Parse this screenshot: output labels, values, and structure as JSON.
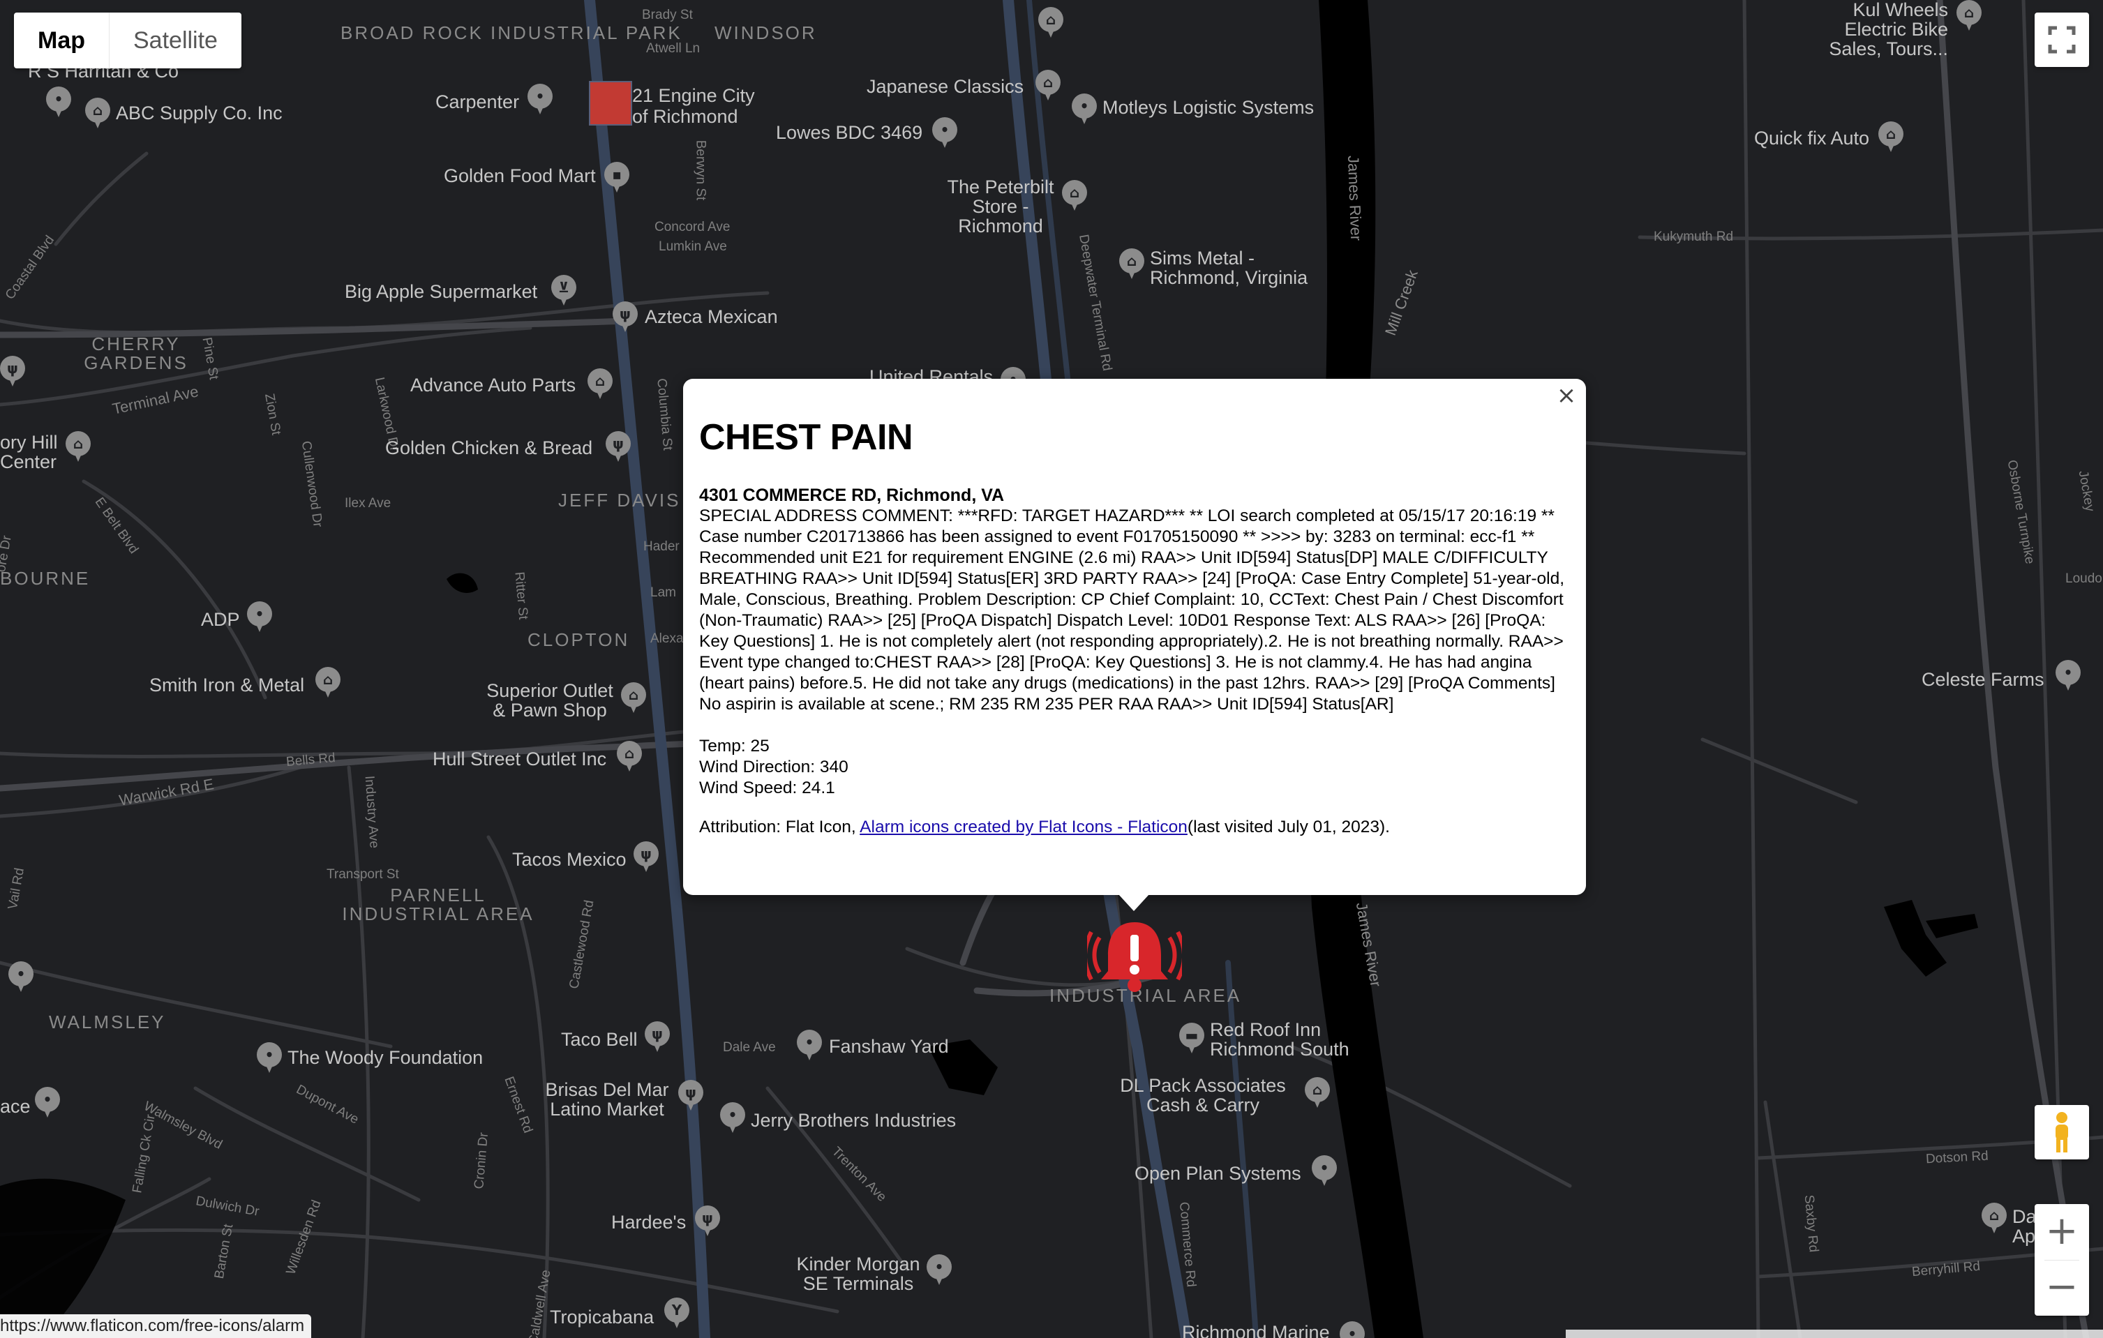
{
  "map_type": {
    "map_label": "Map",
    "satellite_label": "Satellite",
    "active": "Map"
  },
  "info_window": {
    "title": "CHEST PAIN",
    "address": "4301 COMMERCE RD, Richmond, VA",
    "comment": "SPECIAL ADDRESS COMMENT: ***RFD: TARGET HAZARD*** ** LOI search completed at 05/15/17 20:16:19 ** Case number C201713866 has been assigned to event F01705150090 ** >>>> by: 3283 on terminal: ecc-f1 ** Recommended unit E21 for requirement ENGINE (2.6 mi) RAA>> Unit ID[594] Status[DP] MALE C/DIFFICULTY BREATHING RAA>> Unit ID[594] Status[ER] 3RD PARTY RAA>> [24] [ProQA: Case Entry Complete] 51-year-old, Male, Conscious, Breathing. Problem Description: CP Chief Complaint: 10, CCText: Chest Pain / Chest Discomfort (Non-Traumatic) RAA>> [25] [ProQA Dispatch] Dispatch Level: 10D01 Response Text: ALS RAA>> [26] [ProQA: Key Questions] 1. He is not completely alert (not responding appropriately).2. He is not breathing normally. RAA>> Event type changed to:CHEST RAA>> [28] [ProQA: Key Questions] 3. He is not clammy.4. He has had angina (heart pains) before.5. He did not take any drugs (medications) in the past 12hrs. RAA>> [29] [ProQA Comments] No aspirin is available at scene.; RM 235 RM 235 PER RAA RAA>> Unit ID[594] Status[AR]",
    "temp": "Temp: 25",
    "wind_direction": "Wind Direction: 340",
    "wind_speed": "Wind Speed: 24.1",
    "attribution_prefix": "Attribution: Flat Icon, ",
    "attribution_link": "Alarm icons created by Flat Icons - Flaticon",
    "attribution_suffix": "(last visited July 01, 2023).",
    "close_glyph": "×"
  },
  "status_url": "https://www.flaticon.com/free-icons/alarm",
  "zoom": {
    "in": "+",
    "out": "−"
  },
  "colors": {
    "map_bg": "#1f2023",
    "road": "#3c3d41",
    "major_road": "#3b4a60",
    "water": "#000000",
    "pin": "#8c8c8c",
    "alarm": "#d8262b"
  },
  "districts": [
    "BROAD ROCK INDUSTRIAL PARK",
    "WINDSOR",
    "CHERRY GARDENS",
    "JEFF DAVIS",
    "BOURNE",
    "CLOPTON",
    "PARNELL INDUSTRIAL AREA",
    "WALMSLEY",
    "INDUSTRIAL AREA"
  ],
  "places": [
    "R S Harritan & Co",
    "ABC Supply Co. Inc",
    "Carpenter",
    "21 Engine City of Richmond",
    "Japanese Classics",
    "Motleys Logistic Systems",
    "Lowes BDC 3469",
    "Kul Wheels Electric Bike Sales, Tours...",
    "Quick fix Auto",
    "Golden Food Mart",
    "The Peterbilt Store - Richmond",
    "Sims Metal - Richmond, Virginia",
    "Big Apple Supermarket",
    "Azteca Mexican",
    "United Rentals",
    "Advance Auto Parts",
    "Golden Chicken & Bread",
    "ory Hill Center",
    "ADP",
    "Smith Iron & Metal",
    "Superior Outlet & Pawn Shop",
    "Hull Street Outlet Inc",
    "Celeste Farms",
    "Tacos Mexico",
    "Taco Bell",
    "Fanshaw Yard",
    "Red Roof Inn Richmond South",
    "The Woody Foundation",
    "Brisas Del Mar Latino Market",
    "Jerry Brothers Industries",
    "DL Pack Associates Cash & Carry",
    "ace",
    "Open Plan Systems",
    "Hardee's",
    "Kinder Morgan SE Terminals",
    "Tropicabana",
    "Richmond Marine",
    "Da Ap"
  ],
  "streets": [
    "Brady St",
    "Atwell Ln",
    "Berwyn St",
    "Concord Ave",
    "Lumkin Ave",
    "Deepwater Terminal Rd",
    "Kukymuth Rd",
    "Coastal Blvd",
    "Terminal Ave",
    "Pine St",
    "Zion St",
    "Larkwood Dr",
    "Columbia St",
    "Ilex Ave",
    "Cullenwood Dr",
    "E Belt Blvd",
    "Hader",
    "Lam",
    "Ritter St",
    "Alexa",
    "Bells Rd",
    "Warwick Rd E",
    "Industry Ave",
    "Transport St",
    "Castlewood Rd",
    "Dale Ave",
    "Walmsley Blvd",
    "Dupont Ave",
    "Ernest Rd",
    "Cronin Dr",
    "Trenton Ave",
    "Commerce Rd",
    "Dulwich Dr",
    "Barton St",
    "Willesden Rd",
    "Falling Ck Cir",
    "Caldwell Ave",
    "Osborne Turnpike",
    "Loudon",
    "Jockey",
    "Dotson Rd",
    "Saxby Rd",
    "Berryhill Rd",
    "Mill Creek",
    "James River",
    "Vail Rd",
    "ore Dr"
  ]
}
